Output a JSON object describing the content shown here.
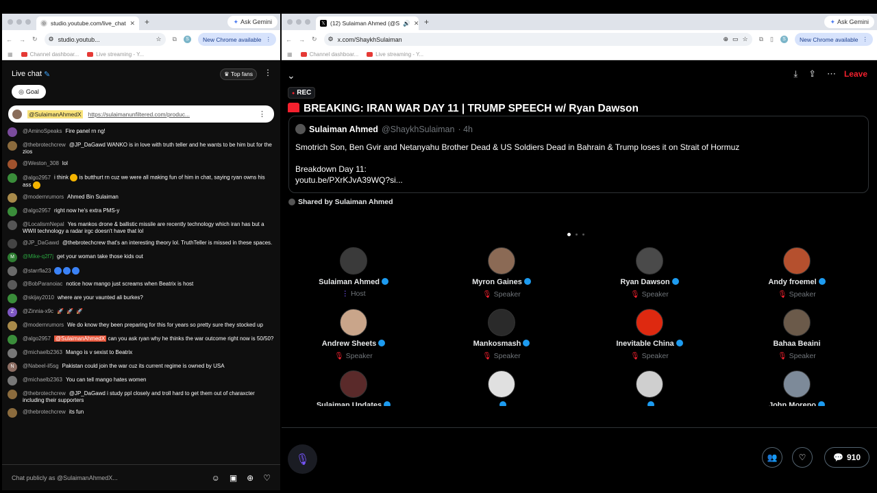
{
  "left_window": {
    "tab_title": "studio.youtube.com/live_chat",
    "address": "studio.youtub...",
    "ask_gemini": "Ask Gemini",
    "new_chrome": "New Chrome available",
    "profile": "S",
    "bookmarks": [
      "Channel dashboar...",
      "Live streaming - Y..."
    ]
  },
  "right_window": {
    "tab_title": "(12) Sulaiman Ahmed (@S",
    "address": "x.com/ShaykhSulaiman",
    "ask_gemini": "Ask Gemini",
    "new_chrome": "New Chrome available",
    "profile": "S",
    "bookmarks": [
      "Channel dashboar...",
      "Live streaming - Y..."
    ]
  },
  "chat": {
    "title": "Live chat",
    "top_fans": "Top fans",
    "goal": "Goal",
    "pinned_author": "@SulaimanAhmedX",
    "pinned_link": "https://sulaimanunfiltered.com/produc...",
    "input_placeholder": "Chat publicly as @SulaimanAhmedX...",
    "messages": [
      {
        "author": "@AminoSpeaks",
        "text": "Fire panel rn ng!",
        "color": "#7a4b9c",
        "initial": ""
      },
      {
        "author": "@thebrotechcrew",
        "text": "@JP_DaGawd WANKO is in love with truth teller and he wants to be him but for the zios",
        "color": "#8b6b3d",
        "initial": ""
      },
      {
        "author": "@Weston_308",
        "text": "lol",
        "color": "#a0522d",
        "initial": ""
      },
      {
        "author": "@algo2957",
        "text": "i think",
        "text2": "is butthurt rn cuz we were all making fun of him in chat, saying ryan owns his ass",
        "color": "#3a8d3a",
        "initial": ""
      },
      {
        "author": "@modernrumors",
        "text": "Ahmed Bin Sulaiman",
        "color": "#a88a4a",
        "initial": ""
      },
      {
        "author": "@algo2957",
        "text": "right now he's extra PMS-y",
        "color": "#3a8d3a",
        "initial": ""
      },
      {
        "author": "@LocalismNepal",
        "text": "Yes mankos drone & ballistic missile are recently technology which iran has but a WWII technology a radar irgc doesn't have that lol",
        "color": "#555",
        "initial": ""
      },
      {
        "author": "@JP_DaGawd",
        "text": "@thebrotechcrew that's an interesting theory lol. TruthTeller is missed in these spaces.",
        "color": "#444",
        "initial": ""
      },
      {
        "author": "@Mike-q2f7j",
        "text": "get your woman take those kids out",
        "color": "#2e7d32",
        "initial": "M"
      },
      {
        "author": "@starrfla23",
        "text": "",
        "color": "#6a6a6a",
        "initial": ""
      },
      {
        "author": "@BobParanoiac",
        "text": "notice how mango just screams when Beatrix is host",
        "color": "#5a5a5a",
        "initial": ""
      },
      {
        "author": "@skijay2010",
        "text": "where are your vaunted ali burkes?",
        "color": "#3a8d3a",
        "initial": ""
      },
      {
        "author": "@Zinnia-x9c",
        "text": "",
        "color": "#7e57c2",
        "initial": "Z"
      },
      {
        "author": "@modernrumors",
        "text": "We do know they been preparing for this for years so pretty sure they stocked up",
        "color": "#a88a4a",
        "initial": ""
      },
      {
        "author": "@algo2957",
        "text": "can you ask ryan why he thinks the war outcome right now is 50/50?",
        "mention": "@SulaimanAhmedX",
        "color": "#3a8d3a",
        "initial": ""
      },
      {
        "author": "@michaelb2363",
        "text": "Mango is v sexist to Beatrix",
        "color": "#777",
        "initial": ""
      },
      {
        "author": "@Nabeel-il5sg",
        "text": "Pakistan could join the war cuz its current regime is owned by USA",
        "color": "#8d6e63",
        "initial": "N"
      },
      {
        "author": "@michaelb2363",
        "text": "You can tell mango hates women",
        "color": "#777",
        "initial": ""
      },
      {
        "author": "@thebrotechcrew",
        "text": "@JP_DaGawd i study ppl closely and troll hard to get them out of charaxcter including their supporters",
        "color": "#8b6b3d",
        "initial": ""
      },
      {
        "author": "@thebrotechcrew",
        "text": "its fun",
        "color": "#8b6b3d",
        "initial": ""
      }
    ]
  },
  "space": {
    "rec": "REC",
    "leave": "Leave",
    "title": "BREAKING: IRAN WAR DAY 11 | TRUMP SPEECH w/ Ryan Dawson",
    "post": {
      "name": "Sulaiman Ahmed",
      "handle": "@ShaykhSulaiman",
      "time": "· 4h",
      "line1": "Smotrich Son, Ben Gvir and Netanyahu Brother Dead & US Soldiers Dead in Bahrain & Trump loses it on Strait of Hormuz",
      "line2": "Breakdown Day 11:",
      "line3": "youtu.be/PXrKJvA39WQ?si..."
    },
    "shared_by": "Shared by Sulaiman Ahmed",
    "listener_count": "910",
    "participants": [
      {
        "name": "Sulaiman Ahmed",
        "role": "Host",
        "verified": true,
        "color": "#3a3a3a"
      },
      {
        "name": "Myron Gaines",
        "role": "Speaker",
        "verified": true,
        "color": "#8b6a55"
      },
      {
        "name": "Ryan Dawson",
        "role": "Speaker",
        "verified": true,
        "color": "#4a4a4a"
      },
      {
        "name": "Andy froemel",
        "role": "Speaker",
        "verified": true,
        "color": "#b5502e"
      },
      {
        "name": "Andrew Sheets",
        "role": "Speaker",
        "verified": true,
        "color": "#c9a58a"
      },
      {
        "name": "Mankosmash",
        "role": "Speaker",
        "verified": true,
        "color": "#2a2a2a"
      },
      {
        "name": "Inevitable China",
        "role": "Speaker",
        "verified": true,
        "color": "#de2910"
      },
      {
        "name": "Bahaa Beaini",
        "role": "Speaker",
        "verified": false,
        "color": "#6b5a4a"
      },
      {
        "name": "Sulaiman Updates",
        "role": "",
        "verified": true,
        "color": "#5a2a2a"
      },
      {
        "name": "",
        "role": "",
        "verified": true,
        "color": "#e0e0e0"
      },
      {
        "name": "",
        "role": "",
        "verified": true,
        "color": "#cfcfcf"
      },
      {
        "name": "John Moreno",
        "role": "",
        "verified": true,
        "color": "#7d8a99"
      }
    ]
  }
}
